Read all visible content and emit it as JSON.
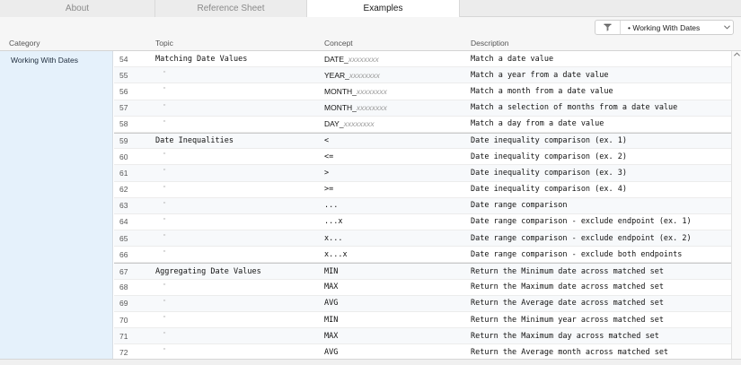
{
  "tabs": [
    {
      "label": "About",
      "active": false
    },
    {
      "label": "Reference Sheet",
      "active": false
    },
    {
      "label": "Examples",
      "active": true
    }
  ],
  "filter": {
    "icon": "funnel-icon",
    "value": "• Working With Dates",
    "chevron": "chevron-down-icon"
  },
  "columns": {
    "category": "Category",
    "topic": "Topic",
    "concept": "Concept",
    "description": "Description"
  },
  "category": "Working With Dates",
  "ditto_mark": "\"",
  "rows": [
    {
      "num": "54",
      "topic": "Matching Date Values",
      "concept_kw": "DATE_",
      "concept_ph": "xxxxxxxx",
      "desc": "Match a date value"
    },
    {
      "num": "55",
      "topic": "",
      "concept_kw": "YEAR_",
      "concept_ph": "xxxxxxxx",
      "desc": "Match a year from a date value"
    },
    {
      "num": "56",
      "topic": "",
      "concept_kw": "MONTH_",
      "concept_ph": "xxxxxxxx",
      "desc": "Match a month from a date value"
    },
    {
      "num": "57",
      "topic": "",
      "concept_kw": "MONTH_",
      "concept_ph": "xxxxxxxx",
      "desc": "Match a selection of months from a date value"
    },
    {
      "num": "58",
      "topic": "",
      "concept_kw": "DAY_",
      "concept_ph": "xxxxxxxx",
      "desc": "Match a day from a date value"
    },
    {
      "num": "59",
      "topic": "Date Inequalities",
      "concept": "<",
      "desc": "Date inequality comparison (ex. 1)"
    },
    {
      "num": "60",
      "topic": "",
      "concept": "<=",
      "desc": "Date inequality comparison (ex. 2)"
    },
    {
      "num": "61",
      "topic": "",
      "concept": ">",
      "desc": "Date inequality comparison (ex. 3)"
    },
    {
      "num": "62",
      "topic": "",
      "concept": ">=",
      "desc": "Date inequality comparison (ex. 4)"
    },
    {
      "num": "63",
      "topic": "",
      "concept": "...",
      "desc": "Date range comparison"
    },
    {
      "num": "64",
      "topic": "",
      "concept": "...x",
      "desc": "Date range comparison - exclude endpoint (ex. 1)"
    },
    {
      "num": "65",
      "topic": "",
      "concept": "x...",
      "desc": "Date range comparison - exclude endpoint (ex. 2)"
    },
    {
      "num": "66",
      "topic": "",
      "concept": "x...x",
      "desc": "Date range comparison - exclude both endpoints"
    },
    {
      "num": "67",
      "topic": "Aggregating Date Values",
      "concept": "MIN",
      "desc": "Return the Minimum date across matched set"
    },
    {
      "num": "68",
      "topic": "",
      "concept": "MAX",
      "desc": "Return the Maximum date across matched set"
    },
    {
      "num": "69",
      "topic": "",
      "concept": "AVG",
      "desc": "Return the Average date across matched set"
    },
    {
      "num": "70",
      "topic": "",
      "concept": "MIN",
      "desc": "Return the Minimum year across matched set"
    },
    {
      "num": "71",
      "topic": "",
      "concept": "MAX",
      "desc": "Return the Maximum day across matched set"
    },
    {
      "num": "72",
      "topic": "",
      "concept": "AVG",
      "desc": "Return the Average month across matched set"
    }
  ],
  "colors": {
    "category_bg": "#e5f1fb",
    "placeholder": "#999999"
  }
}
